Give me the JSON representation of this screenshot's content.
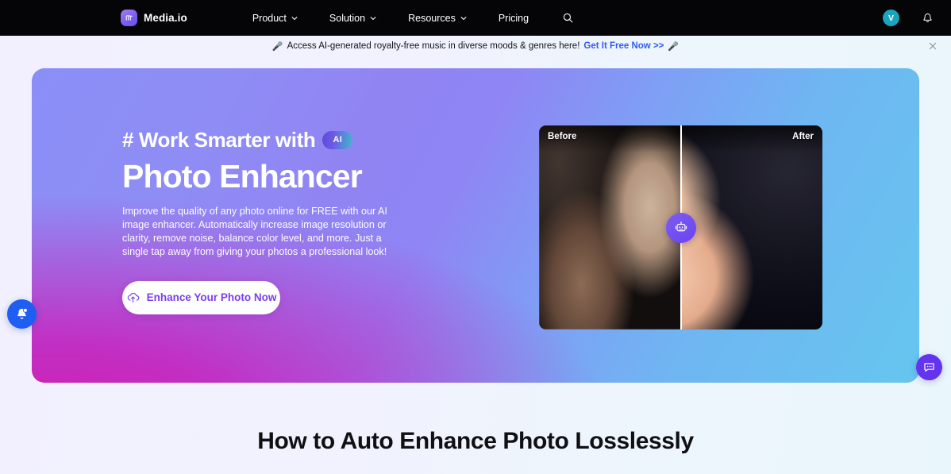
{
  "nav": {
    "brand": "Media.io",
    "brand_icon": "media-io-logo-icon",
    "links": [
      {
        "label": "Product",
        "caret": true
      },
      {
        "label": "Solution",
        "caret": true
      },
      {
        "label": "Resources",
        "caret": true
      },
      {
        "label": "Pricing",
        "caret": false
      }
    ],
    "search_icon": "search-icon",
    "avatar_initial": "V",
    "bell_icon": "bell-icon",
    "bg_color": "#050508"
  },
  "banner": {
    "emoji_left": "🎤",
    "emoji_right": "🎤",
    "text": "Access AI-generated royalty-free music in diverse moods & genres here!",
    "link_label": "Get It Free Now >>",
    "link_color": "#2f5bf6",
    "close_icon": "close-icon"
  },
  "hero": {
    "eyebrow": "# Work Smarter with",
    "ai_badge": "AI",
    "title": "Photo Enhancer",
    "description": "Improve the quality of any photo online for FREE with our AI image enhancer. Automatically increase image resolution or clarity, remove noise, balance color level, and more. Just a single tap away from giving your photos a professional look!",
    "cta_label": "Enhance Your Photo Now",
    "cta_icon": "cloud-upload-icon",
    "cta_text_color": "#7a3ff0",
    "gradient_top_left": "#8a8ff6",
    "gradient_top_right": "#65c6ee",
    "gradient_bottom_left": "#cd21b4"
  },
  "compare": {
    "before_label": "Before",
    "after_label": "After",
    "handle_icon": "robot-ai-icon",
    "divider_position_percent": 50
  },
  "widgets": {
    "notification_icon": "notification-bell-icon",
    "notification_color": "#1e5ef0",
    "chat_icon": "chat-bubble-icon",
    "chat_color": "#6333ee"
  },
  "section": {
    "heading": "How to Auto Enhance Photo Losslessly"
  }
}
